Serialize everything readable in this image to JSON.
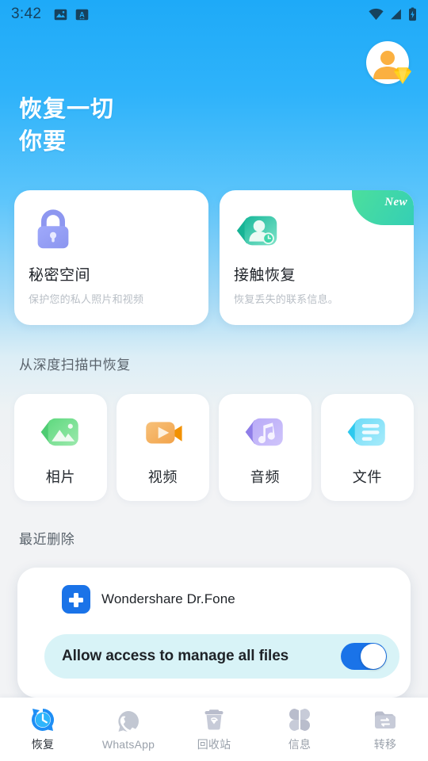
{
  "status_bar": {
    "time": "3:42",
    "left_icons": [
      "photo-icon",
      "text-a-icon"
    ],
    "right_icons": [
      "wifi-icon",
      "signal-icon",
      "battery-charging-icon"
    ]
  },
  "header": {
    "avatar": "user-avatar-vip",
    "title_line1": "恢复一切",
    "title_line2": "你要"
  },
  "feature_cards": [
    {
      "icon": "lock-icon",
      "title": "秘密空间",
      "subtitle": "保护您的私人照片和视频",
      "badge": null,
      "color": "#8e97f2"
    },
    {
      "icon": "contact-restore-icon",
      "title": "接触恢复",
      "subtitle": "恢复丢失的联系信息。",
      "badge": "New",
      "color": "#3fd6aa"
    }
  ],
  "sections": {
    "deep_scan_title": "从深度扫描中恢复",
    "recently_deleted_title": "最近删除"
  },
  "categories": [
    {
      "icon": "photo-gallery-icon",
      "label": "相片",
      "color": "#6fdc8c"
    },
    {
      "icon": "video-camera-icon",
      "label": "视频",
      "color": "#f5b25e"
    },
    {
      "icon": "music-note-icon",
      "label": "音频",
      "color": "#b3a4f5"
    },
    {
      "icon": "document-lines-icon",
      "label": "文件",
      "color": "#5fd9f5"
    }
  ],
  "permission_dialog": {
    "app_icon": "wondershare-plus-icon",
    "app_name": "Wondershare Dr.Fone",
    "option_label": "Allow access to manage all files",
    "toggle_state": "on",
    "toggle_color": "#1a73e8"
  },
  "bottom_nav": {
    "active_index": 0,
    "items": [
      {
        "icon": "restore-clock-icon",
        "label": "恢复"
      },
      {
        "icon": "whatsapp-icon",
        "label": "WhatsApp"
      },
      {
        "icon": "recycle-bin-icon",
        "label": "回收站"
      },
      {
        "icon": "messages-grid-icon",
        "label": "信息"
      },
      {
        "icon": "transfer-folder-icon",
        "label": "转移"
      }
    ]
  },
  "theme": {
    "accent_blue": "#1eaaf8",
    "toggle_blue": "#1a73e8",
    "card_white": "#ffffff"
  }
}
